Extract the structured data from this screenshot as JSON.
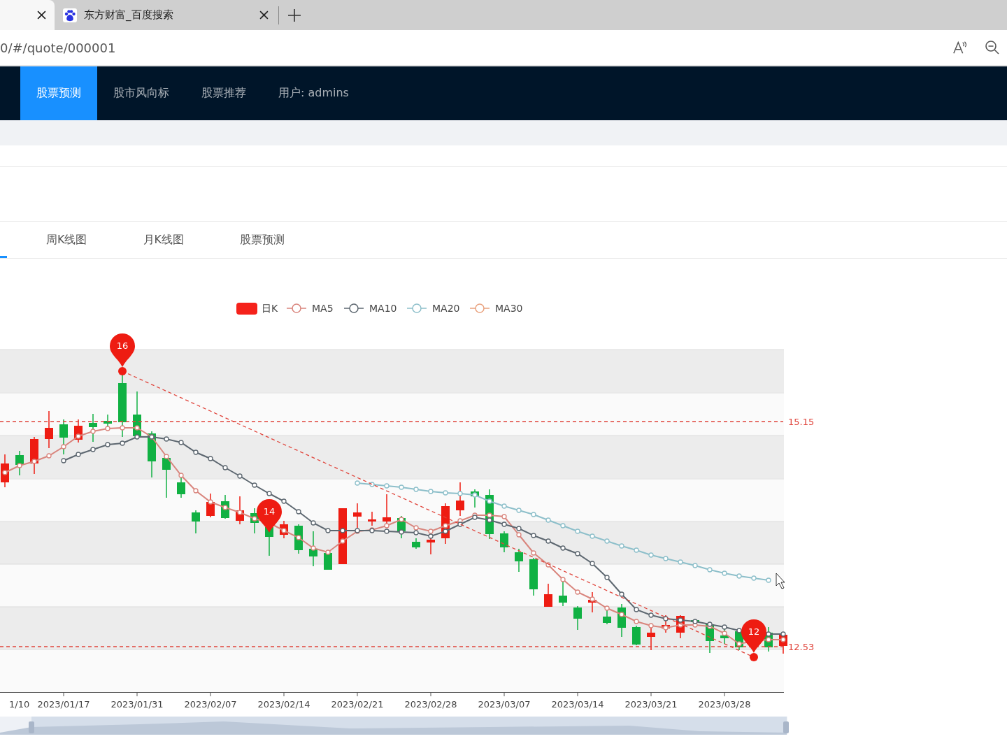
{
  "browser": {
    "tabs": [
      {
        "selected": true
      },
      {
        "title": "东方财富_百度搜索",
        "selected": false
      }
    ],
    "address": "0/#/quote/000001"
  },
  "nav": {
    "items": [
      {
        "label": "股票预测",
        "selected": true
      },
      {
        "label": "股市风向标",
        "selected": false
      },
      {
        "label": "股票推荐",
        "selected": false
      },
      {
        "label": "用户: admins",
        "selected": false
      }
    ]
  },
  "tabs": [
    {
      "selected": true
    },
    {
      "label": "周K线图",
      "selected": false
    },
    {
      "label": "月K线图",
      "selected": false
    },
    {
      "label": "股票预测",
      "selected": false
    }
  ],
  "chart": {
    "legend": [
      {
        "name": "日K",
        "kind": "candle",
        "color": "#f5221b"
      },
      {
        "name": "MA5",
        "kind": "line",
        "color": "#d9857d"
      },
      {
        "name": "MA10",
        "kind": "line",
        "color": "#5d6770"
      },
      {
        "name": "MA20",
        "kind": "line",
        "color": "#8dbfca"
      },
      {
        "name": "MA30",
        "kind": "line",
        "color": "#e9a27e"
      }
    ],
    "pins": [
      {
        "label": "16"
      },
      {
        "label": "14"
      },
      {
        "label": "12"
      }
    ],
    "mark_lines": [
      {
        "label": "15.15"
      },
      {
        "label": "12.53"
      }
    ],
    "slider": {
      "level": 0.96
    },
    "x_labels": [
      "1/10",
      "2023/01/17",
      "2023/01/31",
      "2023/02/07",
      "2023/02/14",
      "2023/02/21",
      "2023/02/28",
      "2023/03/07",
      "2023/03/14",
      "2023/03/21",
      "2023/03/28"
    ]
  }
}
